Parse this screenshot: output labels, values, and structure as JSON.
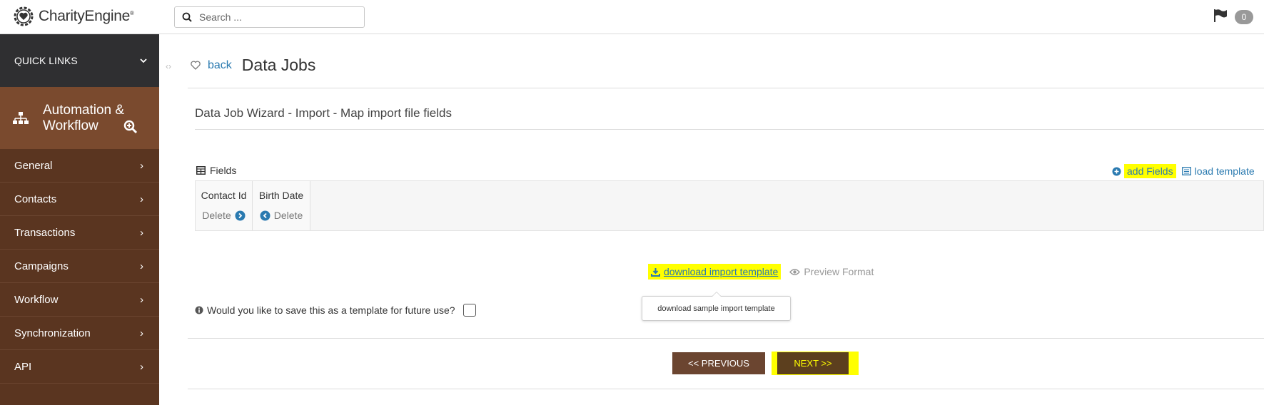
{
  "brand": {
    "name": "CharityEngine",
    "trademark": "®"
  },
  "search": {
    "placeholder": "Search ..."
  },
  "notifications": {
    "count": "0"
  },
  "sidebar": {
    "quick_links": "QUICK LINKS",
    "section_title_line1": "Automation &",
    "section_title_line2": "Workflow",
    "items": [
      {
        "label": "General"
      },
      {
        "label": "Contacts"
      },
      {
        "label": "Transactions"
      },
      {
        "label": "Campaigns"
      },
      {
        "label": "Workflow"
      },
      {
        "label": "Synchronization"
      },
      {
        "label": "API"
      }
    ]
  },
  "header": {
    "back": "back",
    "title": "Data Jobs"
  },
  "wizard": {
    "subtitle": "Data Job Wizard - Import - Map import file fields"
  },
  "fields": {
    "label": "Fields",
    "add_fields": "add Fields",
    "load_template": "load template",
    "columns": [
      {
        "name": "Contact Id",
        "delete": "Delete"
      },
      {
        "name": "Birth Date",
        "delete": "Delete"
      }
    ]
  },
  "download": {
    "link": "download import template",
    "preview": "Preview Format",
    "tooltip": "download sample import template"
  },
  "save_template": {
    "question": "Would you like to save this as a template for future use?"
  },
  "buttons": {
    "previous": "<< PREVIOUS",
    "next": "NEXT >>"
  },
  "colors": {
    "sidebar": "#5a3520",
    "section_head": "#7a4a2e",
    "quick_links": "#2f2f31",
    "link": "#2a7ab0",
    "highlight": "#ffff00"
  }
}
